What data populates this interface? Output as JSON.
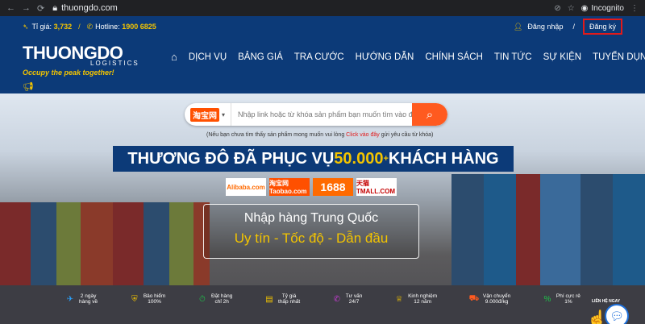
{
  "browser": {
    "url": "thuongdo.com",
    "incognito": "Incognito"
  },
  "topbar": {
    "rate_label": "Tỉ giá:",
    "rate_value": "3,732",
    "hotline_label": "Hotline:",
    "hotline_value": "1900 6825",
    "login": "Đăng nhập",
    "separator": "/",
    "register": "Đăng ký"
  },
  "logo": {
    "name": "THUONGDO",
    "sub": "LOGISTICS",
    "slogan": "Occupy the peak together!"
  },
  "menu": [
    "DỊCH VỤ",
    "BẢNG GIÁ",
    "TRA CƯỚC",
    "HƯỚNG DẪN",
    "CHÍNH SÁCH",
    "TIN TỨC",
    "SỰ KIỆN",
    "TUYỂN DỤNG"
  ],
  "search": {
    "site": "淘宝网",
    "site_sub": "Taobao.com",
    "placeholder": "Nhập link hoặc từ khóa sản phẩm bạn muốn tìm vào đây...",
    "note_pre": "(Nếu bạn chưa tìm thấy sản phẩm mong muốn vui lòng ",
    "note_link": "Click vào đây",
    "note_post": " gửi yêu cầu từ khóa)"
  },
  "banner": {
    "pre": "THƯƠNG ĐÔ ĐÃ PHỤC VỤ ",
    "num": "50.000",
    "sup": "+",
    "post": " KHÁCH HÀNG"
  },
  "brands": [
    {
      "name": "Alibaba.com",
      "bg": "#ffffff",
      "fg": "#ff6a00"
    },
    {
      "name": "淘宝网 Taobao.com",
      "bg": "#ff5000",
      "fg": "#ffffff"
    },
    {
      "name": "1688",
      "bg": "#ff6a00",
      "fg": "#ffffff"
    },
    {
      "name": "天猫 TMALL.COM",
      "bg": "#ffffff",
      "fg": "#c40000"
    }
  ],
  "card": {
    "line1": "Nhập hàng Trung Quốc",
    "line2": "Uy tín - Tốc độ - Dẫn đầu"
  },
  "features": [
    {
      "l1": "2 ngày",
      "l2": "hàng về",
      "color": "#2aa3ff"
    },
    {
      "l1": "Bảo hiểm",
      "l2": "100%",
      "color": "#f3c400"
    },
    {
      "l1": "Đặt hàng",
      "l2": "chỉ 2h",
      "color": "#1ec44a"
    },
    {
      "l1": "Tỷ giá",
      "l2": "thấp nhất",
      "color": "#f3c400"
    },
    {
      "l1": "Tư vấn",
      "l2": "24/7",
      "color": "#c23ccf"
    },
    {
      "l1": "Kinh nghiệm",
      "l2": "12 năm",
      "color": "#f3c400"
    },
    {
      "l1": "Vận chuyển",
      "l2": "9.000đ/kg",
      "color": "#ff5a1f"
    },
    {
      "l1": "Phí cực rẻ",
      "l2": "1%",
      "color": "#1ec44a"
    }
  ],
  "chat": {
    "label": "LIÊN HỆ NGAY"
  }
}
